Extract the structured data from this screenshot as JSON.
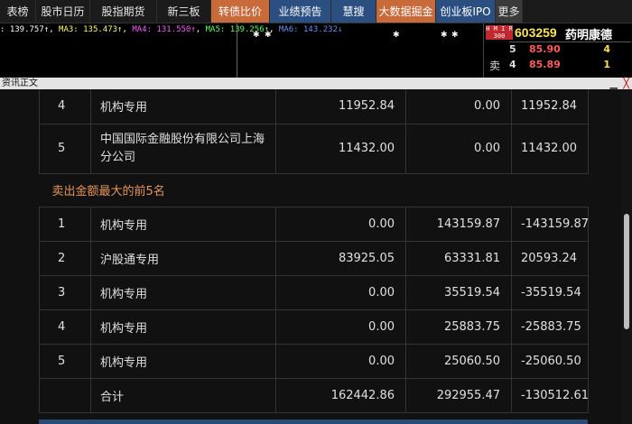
{
  "menubar": {
    "items": [
      {
        "label": "龙虎榜",
        "style": "normal",
        "w": 40,
        "visible": "表榜"
      },
      {
        "label": "股市日历",
        "style": "normal"
      },
      {
        "label": "股指期货",
        "style": "normal"
      },
      {
        "label": "新三板",
        "style": "normal"
      },
      {
        "label": "转债比价",
        "style": "orange"
      },
      {
        "label": "业绩预告",
        "style": "blue"
      },
      {
        "label": "慧搜",
        "style": "blue"
      },
      {
        "label": "大数据掘金",
        "style": "orange"
      },
      {
        "label": "创业板IPO",
        "style": "blue"
      },
      {
        "label": "更多",
        "style": "more"
      }
    ]
  },
  "ma": {
    "ma1": ": 139.757↑",
    "ma3": "MA3: 135.473↑",
    "ma4": "MA4: 131.550↑",
    "ma5": "MA5: 139.256↑",
    "ma6": "MA6: 143.232↓"
  },
  "quote": {
    "tag": "H M I R 300",
    "code": "603259",
    "name": "药明康德",
    "sell_label": "卖",
    "rows": [
      {
        "level": "5",
        "price": "85.90",
        "volume": "4"
      },
      {
        "level": "4",
        "price": "85.89",
        "volume": "1"
      }
    ]
  },
  "news": {
    "title": "资讯正文",
    "min": "▁",
    "close": "╳"
  },
  "buy_tail": [
    {
      "index": "4",
      "name": "机构专用",
      "buy": "11952.84",
      "sell": "0.00",
      "net": "11952.84"
    },
    {
      "index": "5",
      "name": "中国国际金融股份有限公司上海分公司",
      "buy": "11432.00",
      "sell": "0.00",
      "net": "11432.00"
    }
  ],
  "sell_section_title": "卖出金额最大的前5名",
  "sell_rows": [
    {
      "index": "1",
      "name": "机构专用",
      "buy": "0.00",
      "sell": "143159.87",
      "net": "-143159.87"
    },
    {
      "index": "2",
      "name": "沪股通专用",
      "buy": "83925.05",
      "sell": "63331.81",
      "net": "20593.24"
    },
    {
      "index": "3",
      "name": "机构专用",
      "buy": "0.00",
      "sell": "35519.54",
      "net": "-35519.54"
    },
    {
      "index": "4",
      "name": "机构专用",
      "buy": "0.00",
      "sell": "25883.75",
      "net": "-25883.75"
    },
    {
      "index": "5",
      "name": "机构专用",
      "buy": "0.00",
      "sell": "25060.50",
      "net": "-25060.50"
    }
  ],
  "total": {
    "label": "合计",
    "buy": "162442.86",
    "sell": "292955.47",
    "net": "-130512.61"
  }
}
